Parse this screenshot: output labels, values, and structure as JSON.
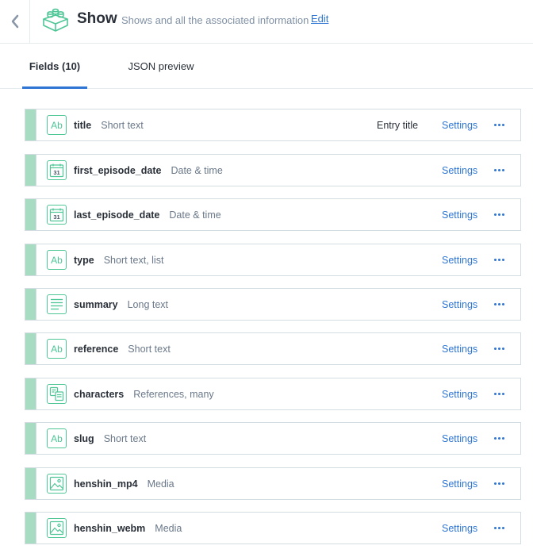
{
  "header": {
    "title": "Show",
    "subtitle": "Shows and all the associated information",
    "edit_label": "Edit"
  },
  "tabs": [
    {
      "label": "Fields (10)",
      "active": true
    },
    {
      "label": "JSON preview",
      "active": false
    }
  ],
  "fields": [
    {
      "name": "title",
      "type": "Short text",
      "icon": "text-icon",
      "entry_title": "Entry title",
      "settings": "Settings"
    },
    {
      "name": "first_episode_date",
      "type": "Date & time",
      "icon": "calendar-icon",
      "settings": "Settings"
    },
    {
      "name": "last_episode_date",
      "type": "Date & time",
      "icon": "calendar-icon",
      "settings": "Settings"
    },
    {
      "name": "type",
      "type": "Short text, list",
      "icon": "text-icon",
      "settings": "Settings"
    },
    {
      "name": "summary",
      "type": "Long text",
      "icon": "long-text-icon",
      "settings": "Settings"
    },
    {
      "name": "reference",
      "type": "Short text",
      "icon": "text-icon",
      "settings": "Settings"
    },
    {
      "name": "characters",
      "type": "References, many",
      "icon": "references-icon",
      "settings": "Settings"
    },
    {
      "name": "slug",
      "type": "Short text",
      "icon": "text-icon",
      "settings": "Settings"
    },
    {
      "name": "henshin_mp4",
      "type": "Media",
      "icon": "media-icon",
      "settings": "Settings"
    },
    {
      "name": "henshin_webm",
      "type": "Media",
      "icon": "media-icon",
      "settings": "Settings"
    }
  ],
  "icon_text": {
    "text_icon": "Ab",
    "calendar_icon": "31"
  },
  "colors": {
    "accent": "#2e75d4",
    "green": "#4fc696",
    "handle": "#a8dcc2",
    "border": "#d3dce0"
  }
}
